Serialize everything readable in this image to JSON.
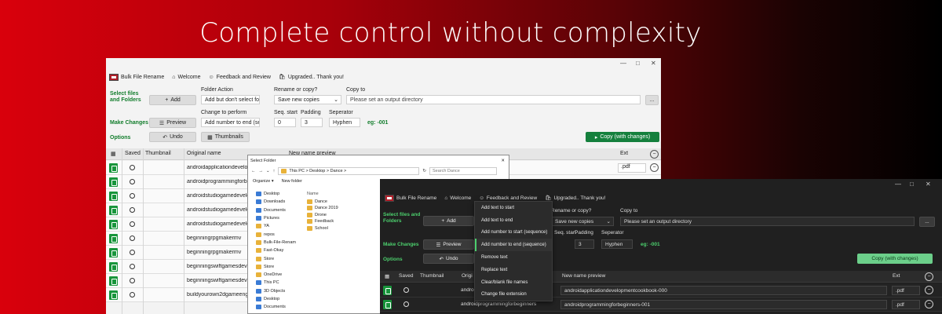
{
  "hero": "Complete control without complexity",
  "light": {
    "menu": {
      "app": "Bulk File Rename",
      "welcome": "Welcome",
      "feedback": "Feedback and Review",
      "upgraded": "Upgraded.. Thank you!"
    },
    "sections": {
      "select": "Select files and Folders",
      "make": "Make Changes",
      "options": "Options"
    },
    "buttons": {
      "add": "Add",
      "preview": "Preview",
      "undo": "Undo",
      "thumbnails": "Thumbnails",
      "copy": "Copy (with changes)",
      "browse": "..."
    },
    "labels": {
      "folder_action": "Folder Action",
      "rename_or_copy": "Rename or copy?",
      "copy_to": "Copy to",
      "change": "Change to perform",
      "seq_start": "Seq. start",
      "padding": "Padding",
      "separator": "Seperator",
      "eg": "eg: -001"
    },
    "values": {
      "folder_action": "Add but don't select folde",
      "rename_or_copy": "Save new copies",
      "copy_to": "Please set an output directory",
      "change": "Add number to end (sequ",
      "seq_start": "0",
      "padding": "3",
      "separator": "Hyphen"
    },
    "columns": {
      "saved": "Saved",
      "thumbnail": "Thumbnail",
      "original": "Original name",
      "preview": "New name preview",
      "ext": "Ext"
    },
    "rows": [
      {
        "name": "androidapplicationdevelopm",
        "ext": ".pdf"
      },
      {
        "name": "androidprogrammingforbegi",
        "ext": ""
      },
      {
        "name": "androidstudiogamedevelopn",
        "ext": ""
      },
      {
        "name": "androidstudiogamedevelopn",
        "ext": ""
      },
      {
        "name": "androidstudiogamedevelopn",
        "ext": ""
      },
      {
        "name": "beginningrpgmakermv",
        "ext": ""
      },
      {
        "name": "beginningrpgmakermv",
        "ext": ""
      },
      {
        "name": "beginningswiftgamesdevelo",
        "ext": ""
      },
      {
        "name": "beginningswiftgamesdevelo",
        "ext": ""
      },
      {
        "name": "buildyourown2dgameengine",
        "ext": ""
      }
    ]
  },
  "dialog": {
    "title": "Select Folder",
    "path": "This PC  >  Desktop  >  Dance  >",
    "search": "Search Dance",
    "organize": "Organize",
    "new_folder": "New folder",
    "tree": [
      "Desktop",
      "Downloads",
      "Documents",
      "Pictures",
      "YA",
      "repos",
      "Bulk-File-Renam",
      "Fast-Okay",
      "Store",
      "Store",
      "OneDrive",
      "This PC",
      "3D Objects",
      "Desktop",
      "Documents"
    ],
    "names_header": "Name",
    "names": [
      "Dance",
      "Dance 2019",
      "Drone",
      "Feedback",
      "School"
    ]
  },
  "dark": {
    "menu": {
      "app": "Bulk File Rename",
      "welcome": "Welcome",
      "feedback": "Feedback and Review",
      "upgraded": "Upgraded.. Thank you!"
    },
    "sections": {
      "select": "Select files and Folders",
      "make": "Make Changes",
      "options": "Options"
    },
    "buttons": {
      "add": "Add",
      "preview": "Preview",
      "undo": "Undo",
      "copy": "Copy (with changes)",
      "browse": "..."
    },
    "labels": {
      "rename_or_copy": "Rename or copy?",
      "copy_to": "Copy to",
      "seq_start": "Seq. start",
      "padding": "Padding",
      "separator": "Seperator",
      "eg": "eg: -001"
    },
    "values": {
      "rename_or_copy": "Save new copies",
      "copy_to": "Please set an output directory",
      "seq_start": "0",
      "padding": "3",
      "separator": "Hyphen"
    },
    "columns": {
      "saved": "Saved",
      "thumbnail": "Thumbnail",
      "original": "Origi",
      "preview": "New name preview",
      "ext": "Ext"
    },
    "rows": [
      {
        "name": "androi",
        "preview": "androidapplicationdevelopmentcookbook-000",
        "ext": ".pdf"
      },
      {
        "name": "androidprogrammingforbeginners",
        "preview": "androidprogrammingforbeginners-001",
        "ext": ".pdf"
      }
    ],
    "dropdown": [
      "Add text to start",
      "Add text to end",
      "Add number to start (sequence)",
      "Add number to end (sequence)",
      "Remove text",
      "Replace text",
      "Clear/blank file names",
      "Change file extension"
    ]
  }
}
